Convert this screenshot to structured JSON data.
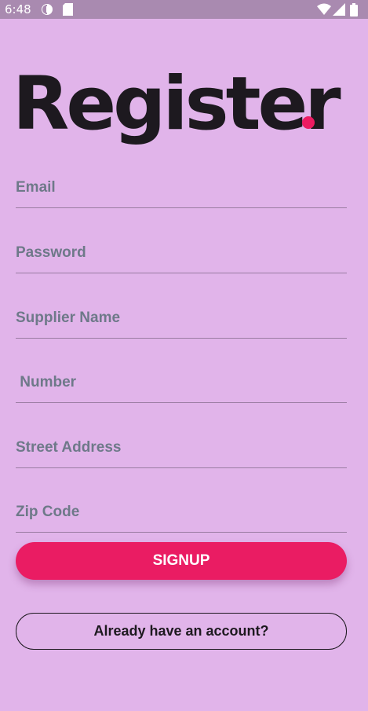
{
  "status_bar": {
    "time": "6:48",
    "left_icons": [
      "data-saver-icon",
      "sd-card-icon"
    ],
    "right_icons": [
      "wifi-icon",
      "signal-icon",
      "battery-icon"
    ]
  },
  "title": "Register",
  "accent_color": "#ed1b62",
  "background_color": "#e1b4ea",
  "form": {
    "email_placeholder": "Email",
    "password_placeholder": "Password",
    "supplier_name_placeholder": "Supplier Name",
    "number_placeholder": " Number",
    "street_address_placeholder": "Street Address",
    "zip_code_placeholder": "Zip Code"
  },
  "buttons": {
    "signup_label": "SIGNUP",
    "login_label": "Already have an account?"
  }
}
